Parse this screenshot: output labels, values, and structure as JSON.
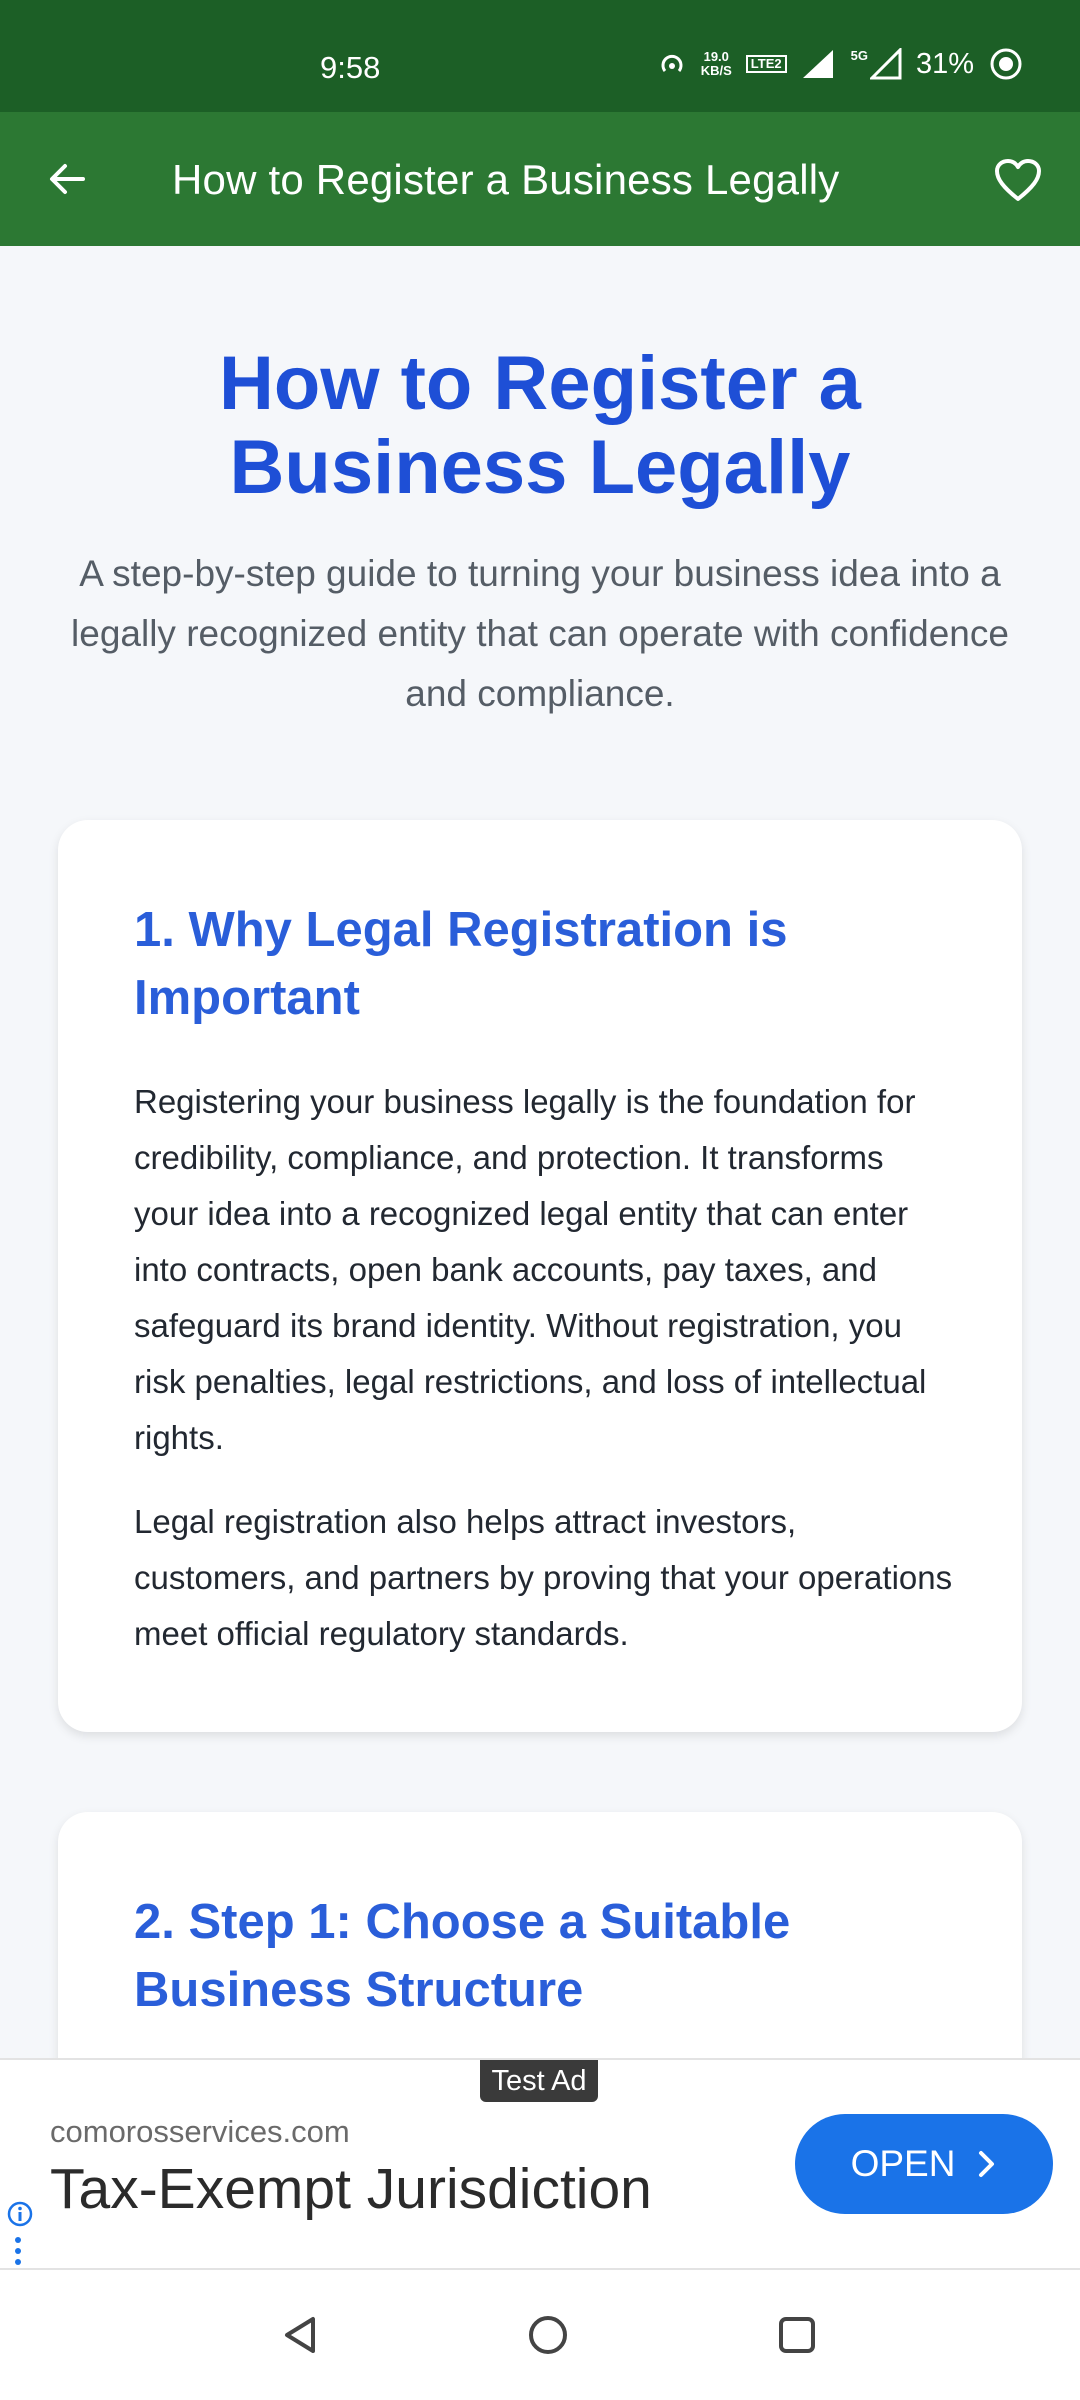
{
  "status_bar": {
    "time": "9:58",
    "speed_value": "19.0",
    "speed_unit": "KB/S",
    "lte_label": "LTE2",
    "network": "5G",
    "battery": "31%"
  },
  "app_bar": {
    "title": "How to Register a Business Legally",
    "back_icon": "arrow-left-icon",
    "favorite_icon": "heart-outline-icon",
    "background_color": "#2c7833"
  },
  "article": {
    "title": "How to Register a Business Legally",
    "subtitle": "A step-by-step guide to turning your business idea into a legally recognized entity that can operate with confidence and compliance.",
    "title_color": "#1e4fd6",
    "sections": [
      {
        "heading": "1. Why Legal Registration is Important",
        "paragraphs": [
          "Registering your business legally is the foundation for credibility, compliance, and protection. It transforms your idea into a recognized legal entity that can enter into contracts, open bank accounts, pay taxes, and safeguard its brand identity. Without registration, you risk penalties, legal restrictions, and loss of intellectual rights.",
          "Legal registration also helps attract investors, customers, and partners by proving that your operations meet official regulatory standards."
        ]
      },
      {
        "heading": "2. Step 1: Choose a Suitable Business Structure",
        "paragraphs": []
      }
    ]
  },
  "ad": {
    "badge": "Test Ad",
    "domain": "comorosservices.com",
    "headline": "Tax-Exempt Jurisdiction",
    "cta_label": "OPEN",
    "cta_color": "#1a73e8"
  },
  "nav_bar": {
    "back_icon": "triangle-back-icon",
    "home_icon": "circle-home-icon",
    "recents_icon": "square-recents-icon"
  }
}
